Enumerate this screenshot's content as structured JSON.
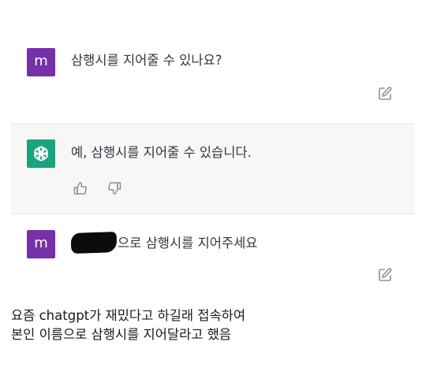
{
  "conversation": {
    "user_message_1": {
      "avatar_letter": "m",
      "text": "삼행시를 지어줄 수 있나요?"
    },
    "assistant_message": {
      "text": "예, 삼행시를 지어줄 수 있습니다."
    },
    "user_message_2": {
      "avatar_letter": "m",
      "text": "으로 삼행시를 지어주세요"
    }
  },
  "caption": {
    "line1": "요즘 chatgpt가 재밌다고 하길래 접속하여",
    "line2": "본인 이름으로 삼행시를 지어달라고 했음"
  },
  "colors": {
    "user_avatar": "#7630a8",
    "assistant_avatar": "#19a37f",
    "assistant_bg": "#f7f7f8"
  },
  "icons": {
    "edit": "edit-icon",
    "thumbs_up": "thumbs-up-icon",
    "thumbs_down": "thumbs-down-icon",
    "assistant_logo": "openai-logo-icon"
  }
}
